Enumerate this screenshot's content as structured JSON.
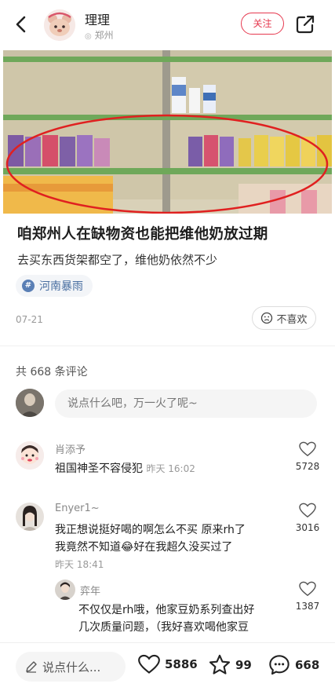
{
  "header": {
    "author": "理理",
    "location": "郑州",
    "follow_label": "关注"
  },
  "post": {
    "title": "咱郑州人在缺物资也能把维他奶放过期",
    "subtitle": "去买东西货架都空了，维他奶依然不少",
    "topic": "河南暴雨",
    "date": "07-21",
    "dislike_label": "不喜欢"
  },
  "comments_section": {
    "count_text": "共 668 条评论",
    "input_placeholder": "说点什么吧，万一火了呢~",
    "comments": [
      {
        "name": "肖添予",
        "text": "祖国神圣不容侵犯",
        "time": "昨天 16:02",
        "likes": "5728"
      },
      {
        "name": "Enyer1~",
        "line1": "我正想说挺好喝的啊怎么不买 原来rh了",
        "line2": "我竟然不知道😂好在我超久没买过了",
        "time": "昨天 18:41",
        "likes": "3016"
      }
    ],
    "reply": {
      "name": "弈年",
      "line1": "不仅仅是rh哦，他家豆奶系列查出好",
      "line2": "几次质量问题，（我好喜欢喝他家豆",
      "likes": "1387"
    }
  },
  "bottom_bar": {
    "input_label": "说点什么...",
    "likes": "5886",
    "stars": "99",
    "comments": "668"
  },
  "colors": {
    "accent": "#e6394f",
    "topic": "#4a6fa1"
  }
}
